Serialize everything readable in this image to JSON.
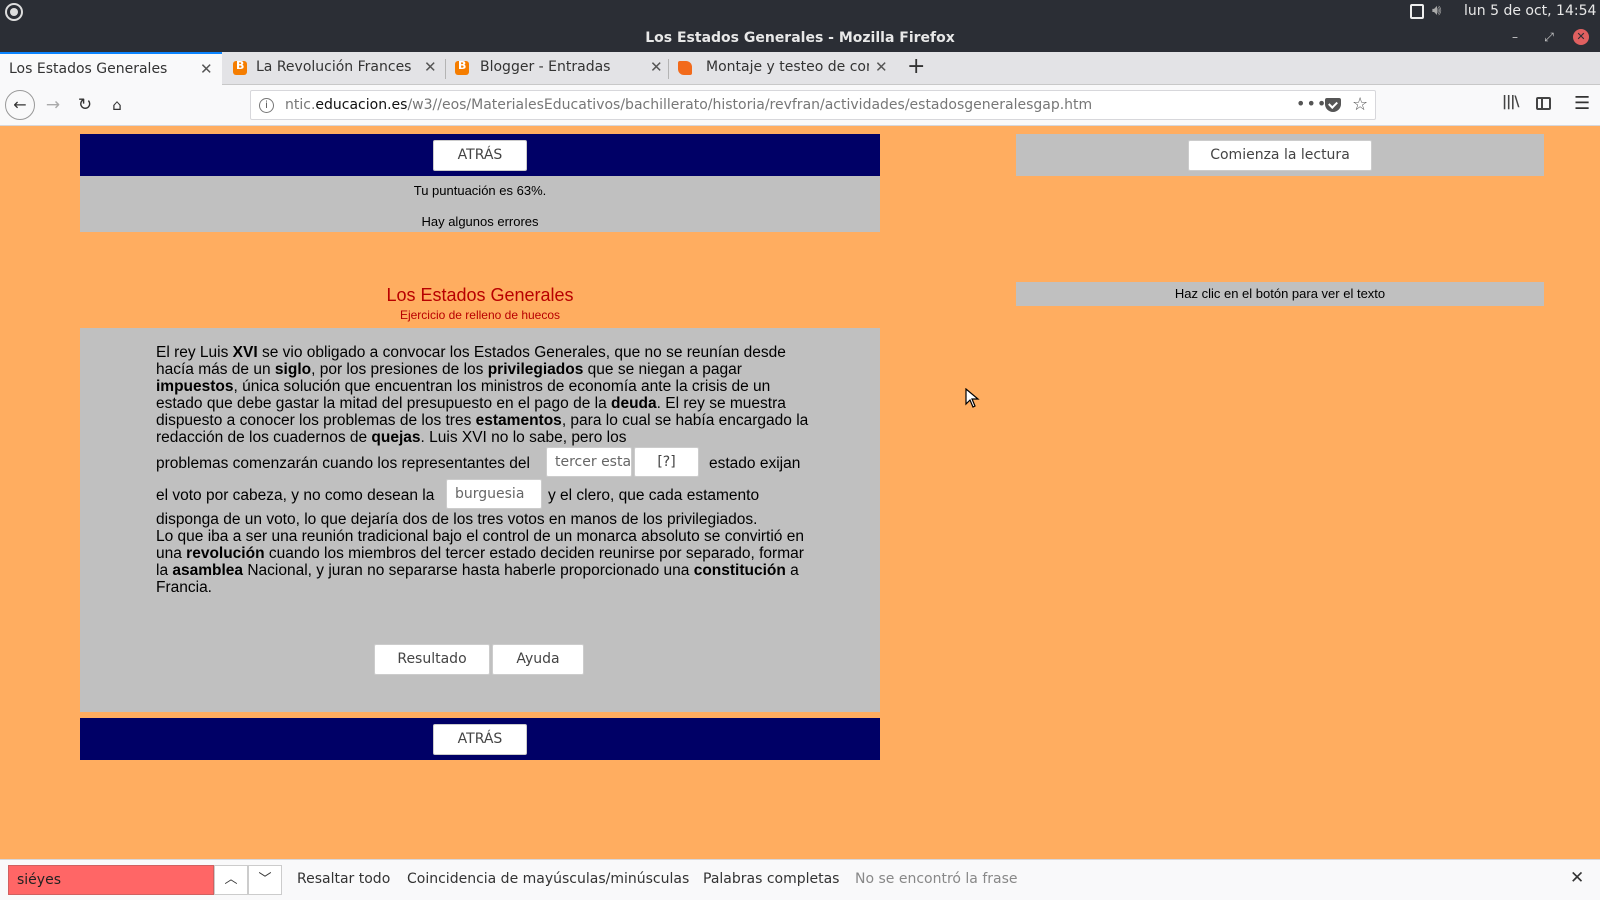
{
  "os": {
    "clock": "lun  5 de oct, 14:54"
  },
  "window": {
    "title": "Los Estados Generales - Mozilla Firefox"
  },
  "tabs": [
    {
      "label": "Los Estados Generales",
      "active": true
    },
    {
      "label": "La Revolución Frances",
      "active": false,
      "favicon": "blogger-icon"
    },
    {
      "label": "Blogger - Entradas",
      "active": false,
      "favicon": "blogger-icon"
    },
    {
      "label": "Montaje y testeo de con",
      "active": false,
      "favicon": "montaje-icon"
    }
  ],
  "url": {
    "prefix": "ntic.",
    "domain": "educacion.es",
    "path": "/w3//eos/MaterialesEducativos/bachillerato/historia/revfran/actividades/estadosgeneralesgap.htm"
  },
  "page": {
    "back_label": "ATRÁS",
    "score_text": "Tu puntuación es 63%.",
    "errors_text": "Hay algunos errores",
    "exercise_title": "Los Estados Generales",
    "exercise_subtitle": "Ejercicio de relleno de huecos",
    "gap1_value": "tercer estado",
    "hint_label": "[?]",
    "gap2_value": "burguesia",
    "line_problems_pre": "problemas comenzarán cuando los representantes del",
    "line_problems_post": "estado exijan",
    "line_vote_pre": "el voto por cabeza, y no como desean la",
    "line_vote_post": "y el clero, que cada estamento",
    "result_label": "Resultado",
    "help_label": "Ayuda",
    "start_reading_label": "Comienza la lectura",
    "reading_hint": "Haz clic en el botón para ver el texto"
  },
  "find_bar": {
    "query": "siéyes",
    "highlight_all": "Resaltar todo",
    "match_case": "Coincidencia de mayúsculas/minúsculas",
    "whole_words": "Palabras completas",
    "status": "No se encontró la frase"
  }
}
